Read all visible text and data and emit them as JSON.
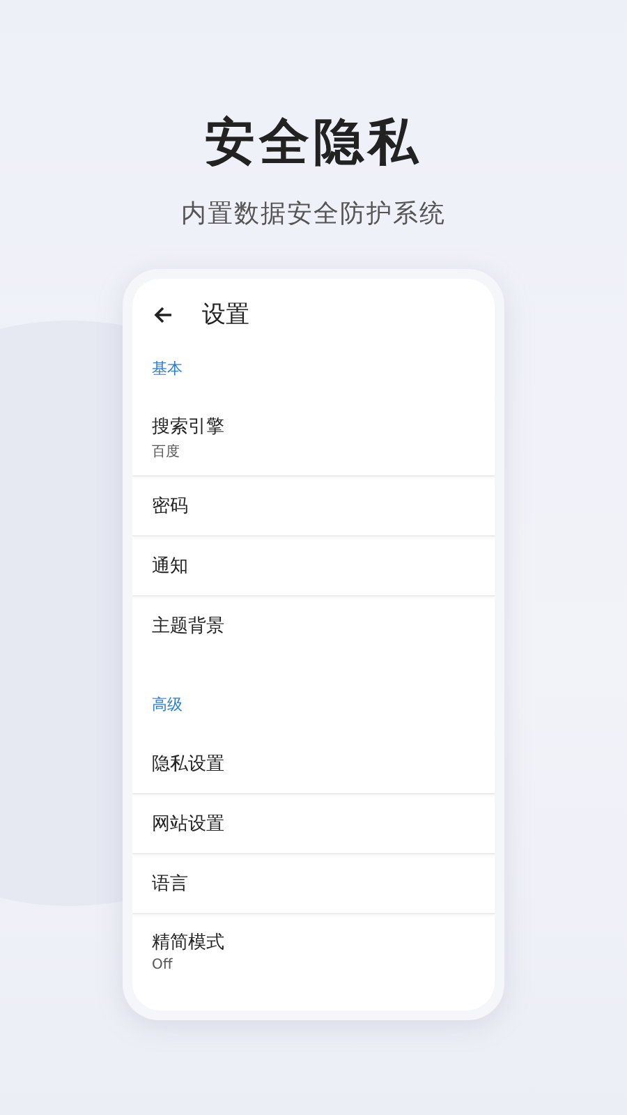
{
  "headline": "安全隐私",
  "subtitle": "内置数据安全防护系统",
  "screen": {
    "title": "设置",
    "items": [
      {
        "kind": "section",
        "label": "基本"
      },
      {
        "kind": "item",
        "label": "搜索引擎",
        "value": "百度"
      },
      {
        "kind": "item",
        "label": "密码"
      },
      {
        "kind": "item",
        "label": "通知"
      },
      {
        "kind": "item",
        "label": "主题背景"
      },
      {
        "kind": "section",
        "label": "高级"
      },
      {
        "kind": "item",
        "label": "隐私设置"
      },
      {
        "kind": "item",
        "label": "网站设置"
      },
      {
        "kind": "item",
        "label": "语言"
      },
      {
        "kind": "item",
        "label": "精简模式",
        "value": "Off"
      }
    ]
  }
}
